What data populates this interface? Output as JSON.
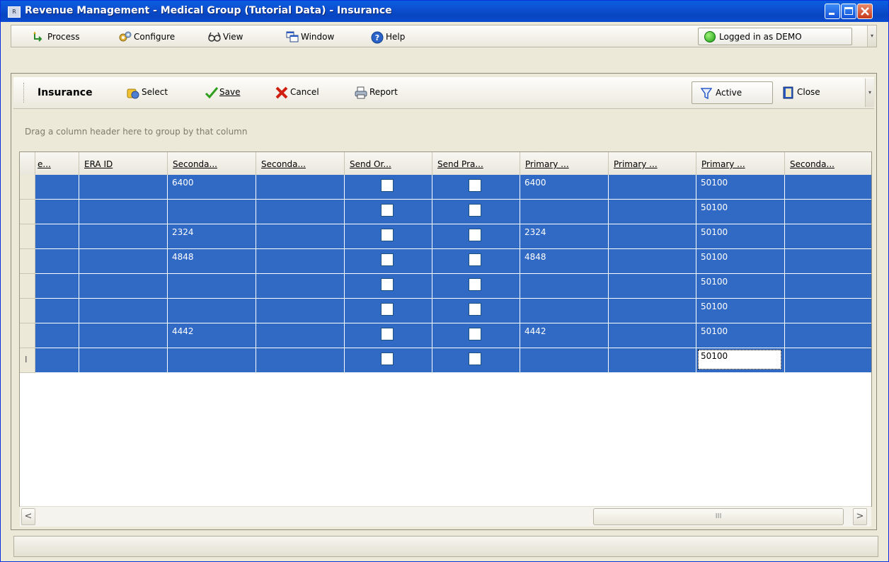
{
  "window": {
    "title": "Revenue Management - Medical Group (Tutorial Data) - Insurance",
    "app_icon_text": "R"
  },
  "menubar": {
    "items": [
      {
        "label": "Process",
        "icon": "process-icon"
      },
      {
        "label": "Configure",
        "icon": "configure-icon"
      },
      {
        "label": "View",
        "icon": "glasses-icon"
      },
      {
        "label": "Window",
        "icon": "window-icon"
      },
      {
        "label": "Help",
        "icon": "help-icon"
      }
    ],
    "status": "Logged in as DEMO",
    "status_color": "#1a9a12"
  },
  "toolbar": {
    "title": "Insurance",
    "select": "Select",
    "save": "Save",
    "cancel": "Cancel",
    "report": "Report",
    "active": "Active",
    "close": "Close"
  },
  "grid": {
    "group_hint": "Drag a column header here to group by that column",
    "columns": [
      "e...",
      "ERA ID",
      "Seconda...",
      "Seconda...",
      "Send Or...",
      "Send Pra...",
      "Primary ...",
      "Primary ...",
      "Primary ...",
      "Seconda..."
    ],
    "rows": [
      {
        "era_id": "",
        "secondary_1": "6400",
        "secondary_2": "",
        "send_orig": false,
        "send_prac": false,
        "primary_1": "6400",
        "primary_2": "",
        "primary_3": "50100",
        "secondary_3": ""
      },
      {
        "era_id": "",
        "secondary_1": "",
        "secondary_2": "",
        "send_orig": false,
        "send_prac": false,
        "primary_1": "",
        "primary_2": "",
        "primary_3": "50100",
        "secondary_3": ""
      },
      {
        "era_id": "",
        "secondary_1": "2324",
        "secondary_2": "",
        "send_orig": false,
        "send_prac": false,
        "primary_1": "2324",
        "primary_2": "",
        "primary_3": "50100",
        "secondary_3": ""
      },
      {
        "era_id": "",
        "secondary_1": "4848",
        "secondary_2": "",
        "send_orig": false,
        "send_prac": false,
        "primary_1": "4848",
        "primary_2": "",
        "primary_3": "50100",
        "secondary_3": ""
      },
      {
        "era_id": "",
        "secondary_1": "",
        "secondary_2": "",
        "send_orig": false,
        "send_prac": false,
        "primary_1": "",
        "primary_2": "",
        "primary_3": "50100",
        "secondary_3": ""
      },
      {
        "era_id": "",
        "secondary_1": "",
        "secondary_2": "",
        "send_orig": false,
        "send_prac": false,
        "primary_1": "",
        "primary_2": "",
        "primary_3": "50100",
        "secondary_3": ""
      },
      {
        "era_id": "",
        "secondary_1": "4442",
        "secondary_2": "",
        "send_orig": false,
        "send_prac": false,
        "primary_1": "4442",
        "primary_2": "",
        "primary_3": "50100",
        "secondary_3": ""
      },
      {
        "era_id": "",
        "secondary_1": "",
        "secondary_2": "",
        "send_orig": false,
        "send_prac": false,
        "primary_1": "",
        "primary_2": "",
        "primary_3": "50100",
        "secondary_3": "",
        "editing": true
      }
    ],
    "selection_color": "#316ac5",
    "edit_row_marker": "I"
  },
  "scrollbar": {
    "left_arrow": "<",
    "right_arrow": ">",
    "thumb_grip": "III"
  }
}
